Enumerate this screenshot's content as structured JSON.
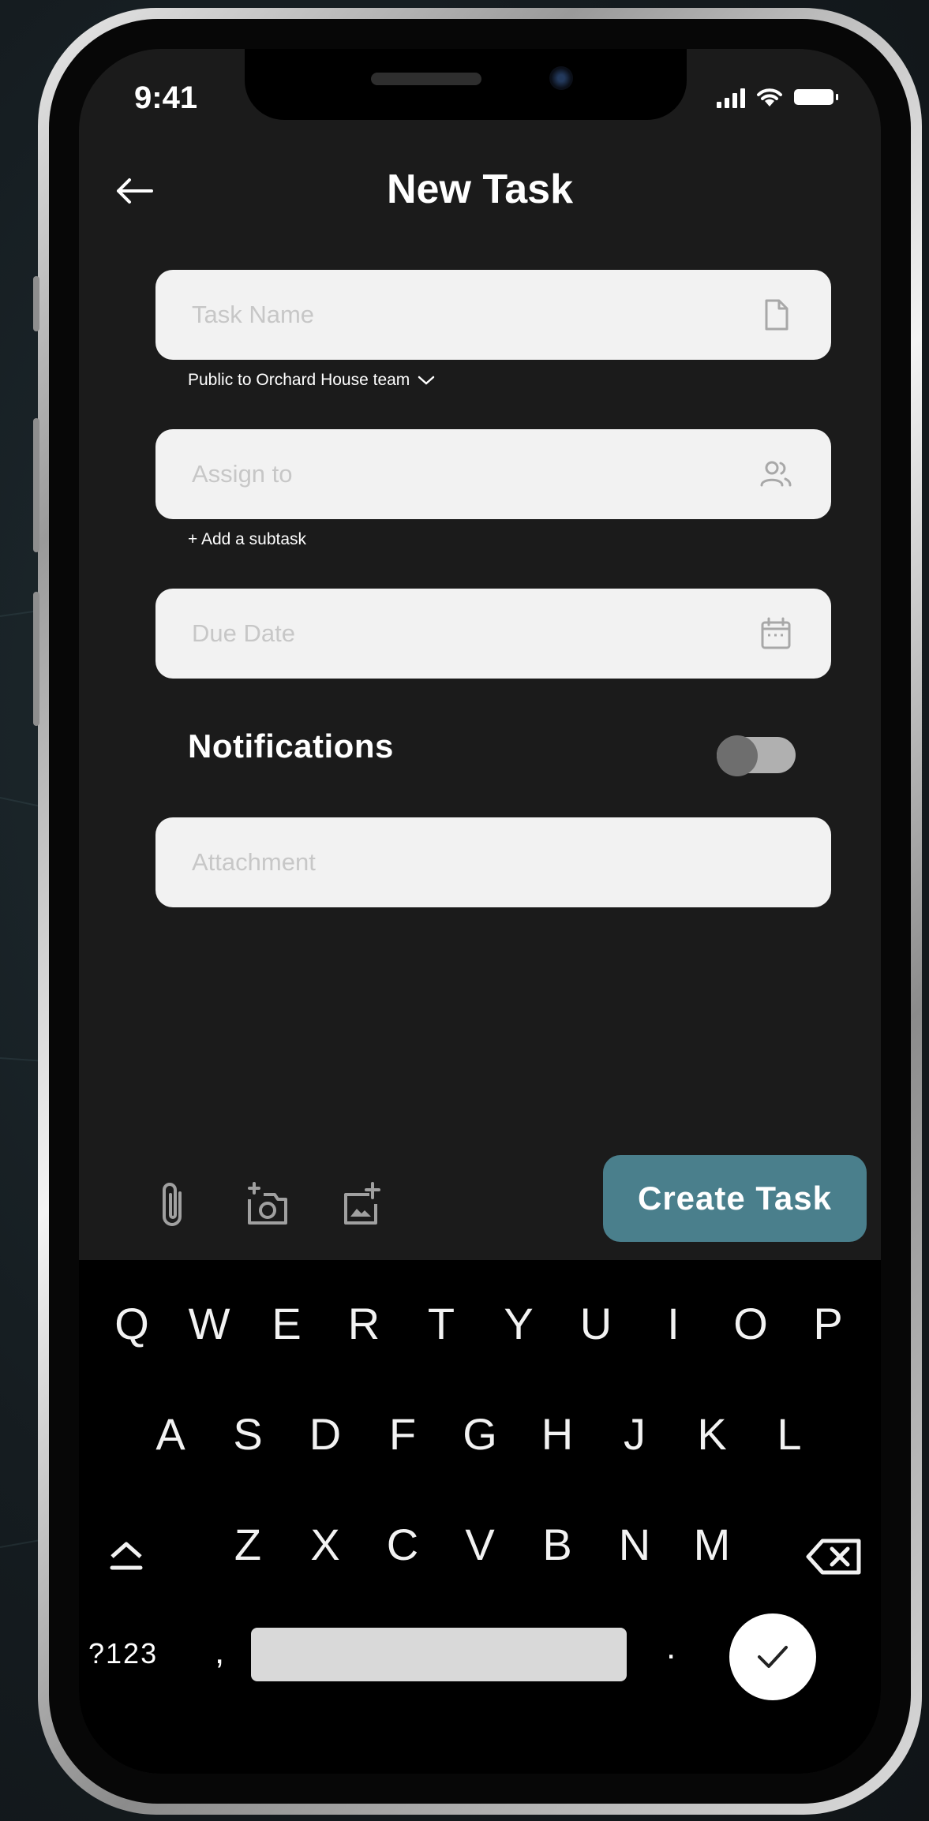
{
  "status_bar": {
    "time": "9:41"
  },
  "header": {
    "title": "New Task"
  },
  "form": {
    "task_name": {
      "placeholder": "Task Name"
    },
    "visibility": {
      "label": "Public to Orchard House team"
    },
    "assign_to": {
      "placeholder": "Assign to"
    },
    "add_subtask": {
      "label": "+ Add a subtask"
    },
    "due_date": {
      "placeholder": "Due Date"
    },
    "notifications": {
      "label": "Notifications",
      "enabled": false
    },
    "attachment": {
      "placeholder": "Attachment"
    }
  },
  "toolbar": {
    "create_label": "Create Task"
  },
  "keyboard": {
    "row1": [
      "Q",
      "W",
      "E",
      "R",
      "T",
      "Y",
      "U",
      "I",
      "O",
      "P"
    ],
    "row2": [
      "A",
      "S",
      "D",
      "F",
      "G",
      "H",
      "J",
      "K",
      "L"
    ],
    "row3": [
      "Z",
      "X",
      "C",
      "V",
      "B",
      "N",
      "M"
    ],
    "symbols_label": "?123",
    "comma": ",",
    "period": "."
  },
  "colors": {
    "screen_bg": "#1b1b1b",
    "field_bg": "#f2f2f2",
    "accent": "#4a7f8c",
    "keyboard_bg": "#000000"
  }
}
